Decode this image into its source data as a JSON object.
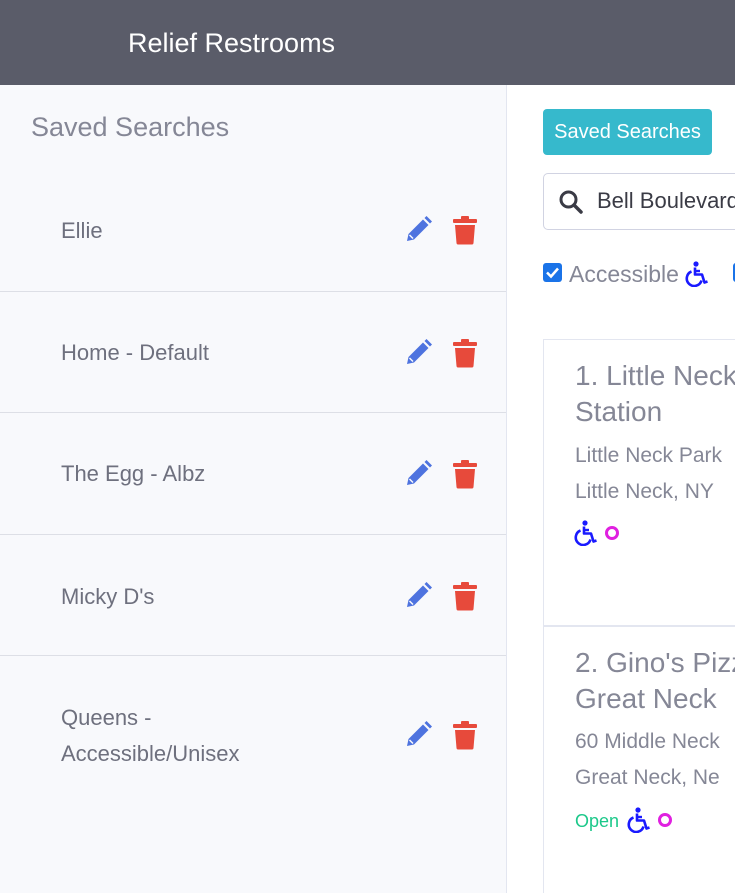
{
  "app": {
    "title": "Relief Restrooms"
  },
  "sidebar": {
    "title": "Saved Searches",
    "items": [
      {
        "label": "Ellie"
      },
      {
        "label": "Home - Default"
      },
      {
        "label": "The Egg - Albz"
      },
      {
        "label": "Micky D's"
      },
      {
        "label": "Queens -\nAccessible/Unisex"
      }
    ],
    "edit_icon": "pencil-icon",
    "delete_icon": "trash-icon"
  },
  "main": {
    "saved_searches_button": "Saved Searches",
    "search": {
      "value": "Bell Boulevard"
    },
    "filters": [
      {
        "label": "Accessible",
        "checked": true,
        "icon": "wheelchair-icon"
      },
      {
        "label": "",
        "checked": false
      }
    ],
    "results": [
      {
        "title": "1. Little Neck\nStation",
        "address_line1": "Little Neck Park",
        "address_line2": "Little Neck, NY",
        "status": "",
        "icons": [
          "wheelchair-icon",
          "ring-icon"
        ]
      },
      {
        "title": "2. Gino's Pizz\nGreat Neck",
        "address_line1": "60 Middle Neck",
        "address_line2": "Great Neck, Ne",
        "status": "Open",
        "icons": [
          "wheelchair-icon",
          "ring-icon"
        ]
      }
    ]
  },
  "colors": {
    "navbar": "#5a5c69",
    "button": "#36b9cc",
    "edit": "#4e73df",
    "delete": "#e74a3b",
    "open": "#1cc88a",
    "accessible": "#1a1aff",
    "unisex": "#e020e0"
  }
}
